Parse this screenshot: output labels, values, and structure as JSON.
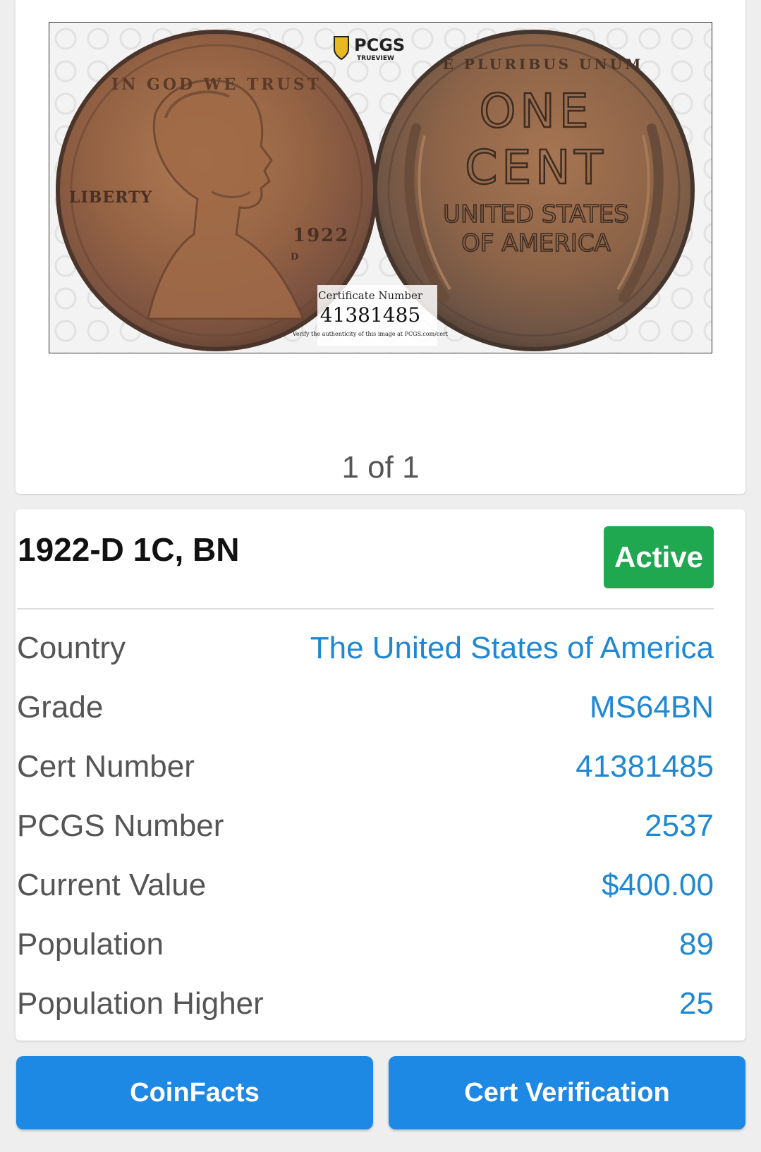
{
  "image_card": {
    "logo_text": "PCGS",
    "logo_subtext": "TRUEVIEW",
    "obverse": {
      "motto": "IN GOD WE TRUST",
      "legend": "LIBERTY",
      "date": "1922",
      "mintmark": "D"
    },
    "reverse": {
      "top_legend": "E PLURIBUS UNUM",
      "line1": "ONE",
      "line2": "CENT",
      "line3": "UNITED STATES",
      "line4": "OF AMERICA"
    },
    "cert_caption": "Certificate Number",
    "cert_number_image": "41381485",
    "verify_text": "Verify the authenticity of this image at PCGS.com/cert",
    "counter": "1 of 1"
  },
  "details": {
    "title": "1922-D 1C, BN",
    "status": "Active",
    "status_color": "#1fa84f",
    "rows": [
      {
        "label": "Country",
        "value": "The United States of America"
      },
      {
        "label": "Grade",
        "value": "MS64BN"
      },
      {
        "label": "Cert Number",
        "value": "41381485"
      },
      {
        "label": "PCGS Number",
        "value": "2537"
      },
      {
        "label": "Current Value",
        "value": "$400.00"
      },
      {
        "label": "Population",
        "value": "89"
      },
      {
        "label": "Population Higher",
        "value": "25"
      }
    ],
    "value_color": "#1f88d4"
  },
  "actions": {
    "coinfacts_label": "CoinFacts",
    "cert_verification_label": "Cert Verification",
    "button_color": "#1e88e5"
  }
}
